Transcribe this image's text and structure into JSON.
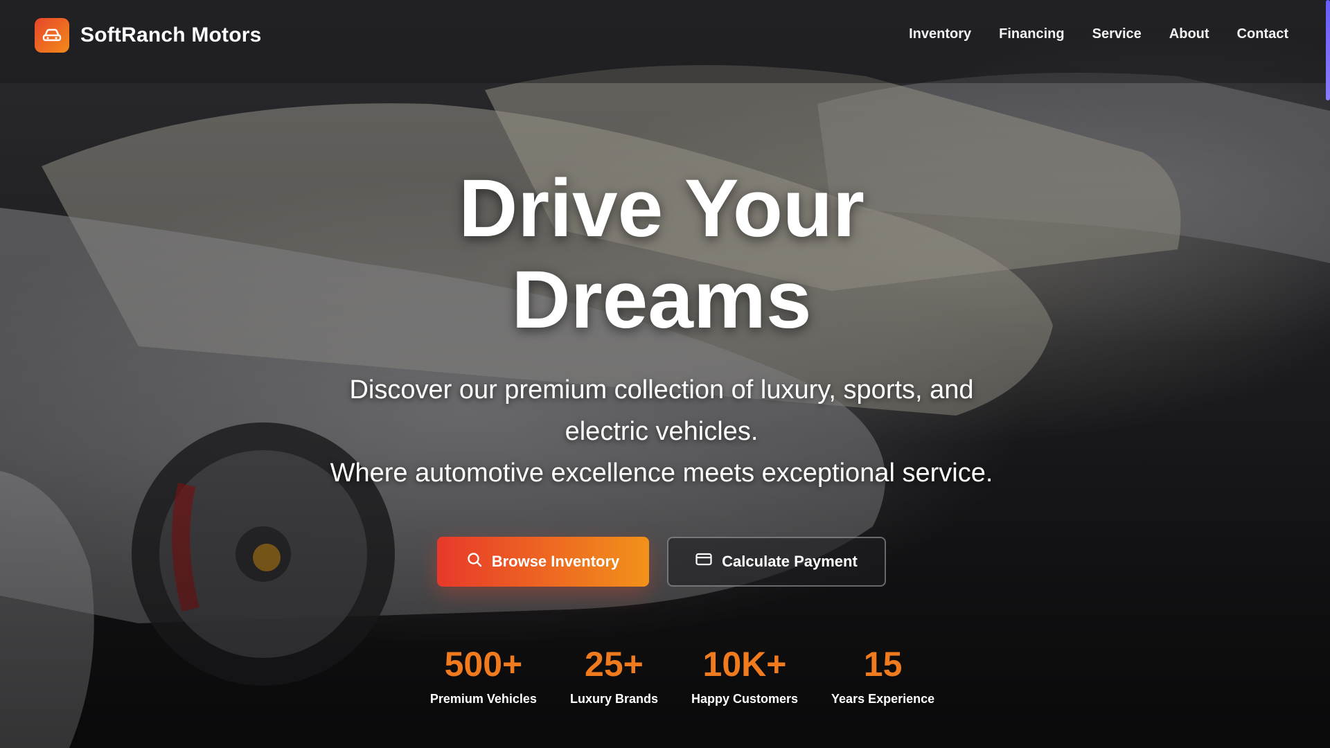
{
  "brand": {
    "name": "SoftRanch Motors",
    "logo_icon": "car-icon",
    "accent_start": "#e8392a",
    "accent_end": "#f2921a"
  },
  "nav": {
    "items": [
      "Inventory",
      "Financing",
      "Service",
      "About",
      "Contact"
    ]
  },
  "hero": {
    "title_line1": "Drive Your",
    "title_line2": "Dreams",
    "subtitle_line1": "Discover our premium collection of luxury, sports, and electric vehicles.",
    "subtitle_line2": "Where automotive excellence meets exceptional service.",
    "primary_button": {
      "label": "Browse Inventory",
      "icon": "search-icon"
    },
    "secondary_button": {
      "label": "Calculate Payment",
      "icon": "credit-card-icon"
    }
  },
  "stats": [
    {
      "value": "500+",
      "label": "Premium Vehicles"
    },
    {
      "value": "25+",
      "label": "Luxury Brands"
    },
    {
      "value": "10K+",
      "label": "Happy Customers"
    },
    {
      "value": "15",
      "label": "Years Experience"
    }
  ],
  "colors": {
    "stat_value": "#f07a1e",
    "scroll_indicator": "#6a5cff"
  }
}
